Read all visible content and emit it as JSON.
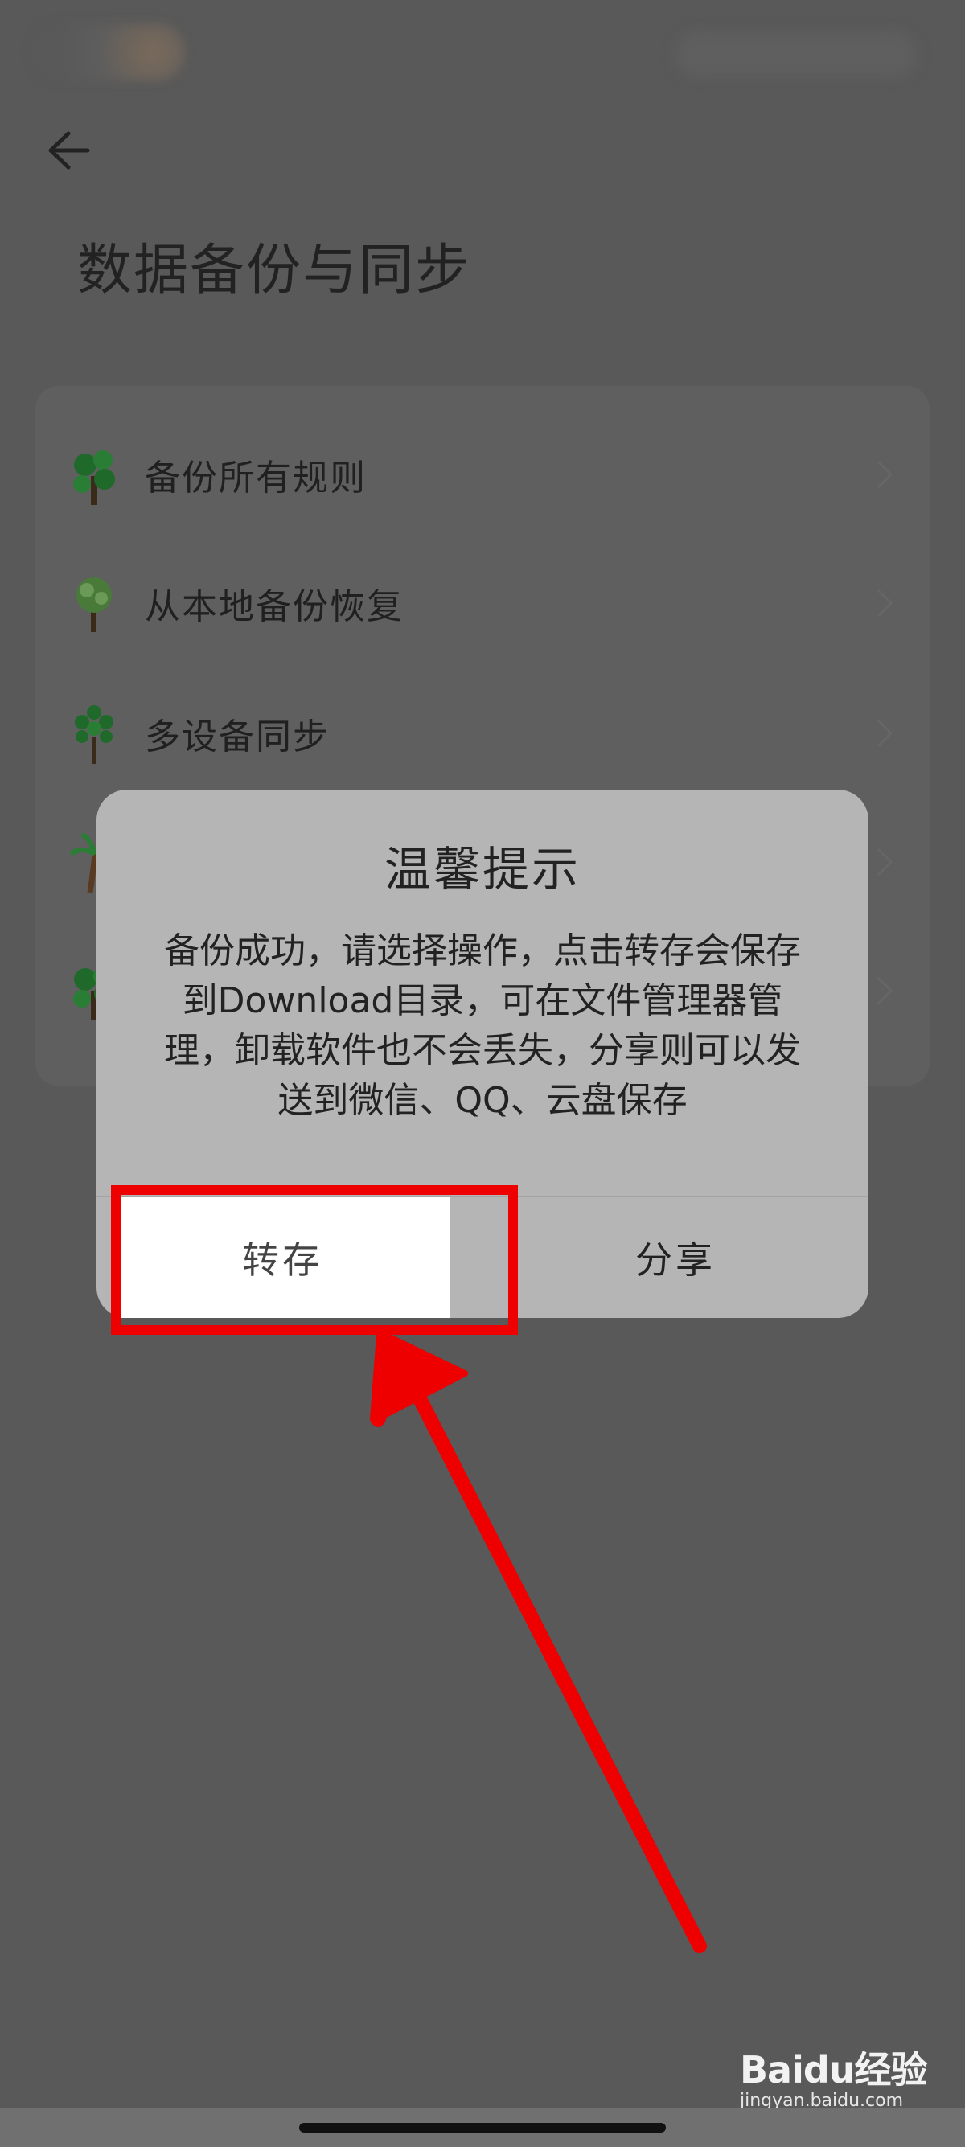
{
  "header": {
    "title": "数据备份与同步"
  },
  "menu": {
    "items": [
      {
        "label": "备份所有规则",
        "icon": "tree-icon"
      },
      {
        "label": "从本地备份恢复",
        "icon": "tree-icon"
      },
      {
        "label": "多设备同步",
        "icon": "tree-icon"
      },
      {
        "label": "",
        "icon": "palm-tree-icon"
      },
      {
        "label": "",
        "icon": "tree-icon"
      }
    ]
  },
  "dialog": {
    "title": "温馨提示",
    "message": "备份成功，请选择操作，点击转存会保存到Download目录，可在文件管理器管理，卸载软件也不会丢失，分享则可以发送到微信、QQ、云盘保存",
    "save_label": "转存",
    "share_label": "分享"
  },
  "annotation": {
    "highlight_color": "#ee0000"
  },
  "watermark": {
    "logo": "Baidu经验",
    "url": "jingyan.baidu.com"
  },
  "colors": {
    "backdrop": "#595959",
    "dialog": "#b5b5b5",
    "tree_green": "#1f6a2a"
  }
}
